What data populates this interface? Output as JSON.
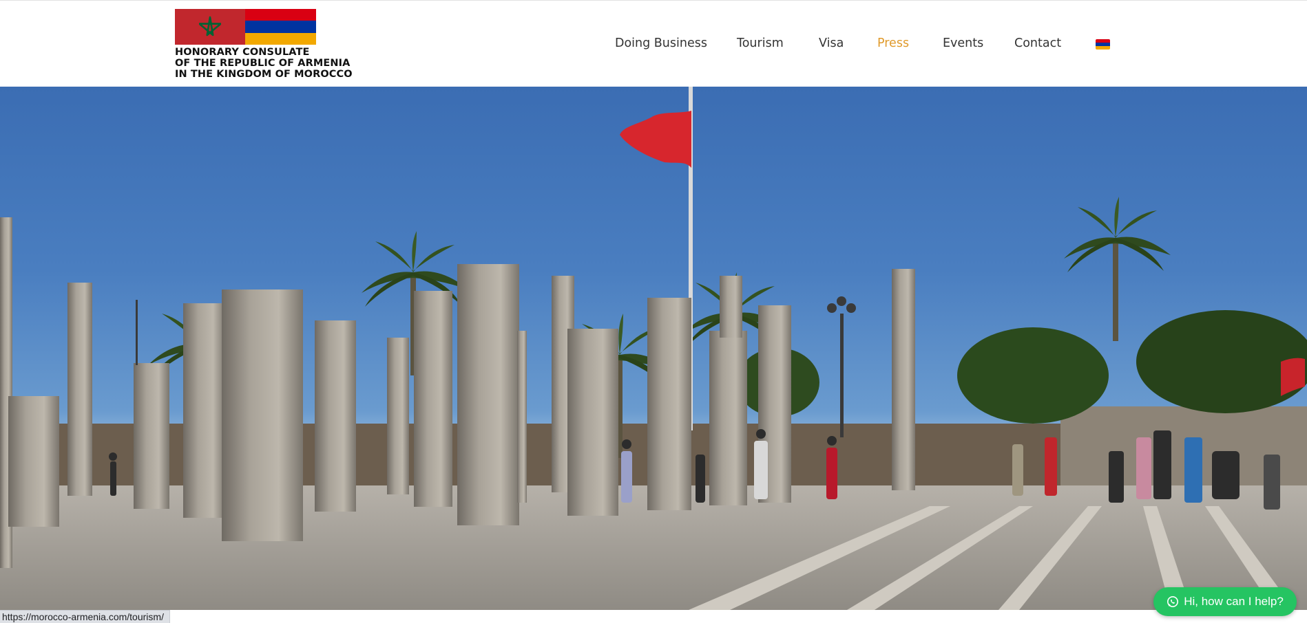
{
  "header": {
    "logo": {
      "line1": "HONORARY CONSULATE",
      "line2": "OF THE REPUBLIC OF ARMENIA",
      "line3": "IN THE KINGDOM OF MOROCCO"
    },
    "nav": [
      {
        "label": "Doing Business",
        "active": false
      },
      {
        "label": "Tourism",
        "active": false
      },
      {
        "label": "Visa",
        "active": false
      },
      {
        "label": "Press",
        "active": true
      },
      {
        "label": "Events",
        "active": false
      },
      {
        "label": "Contact",
        "active": false
      }
    ],
    "language_icon": "armenia-flag-icon"
  },
  "chat": {
    "label": "Hi, how can I help?",
    "icon": "whatsapp-icon",
    "color": "#25c462"
  },
  "status_bar": {
    "url": "https://morocco-armenia.com/tourism/"
  },
  "colors": {
    "active_nav": "#e09a2b",
    "nav_text": "#333333",
    "morocco_red": "#c1272d",
    "armenia_red": "#d90012",
    "armenia_blue": "#0033a0",
    "armenia_orange": "#f2a800"
  }
}
